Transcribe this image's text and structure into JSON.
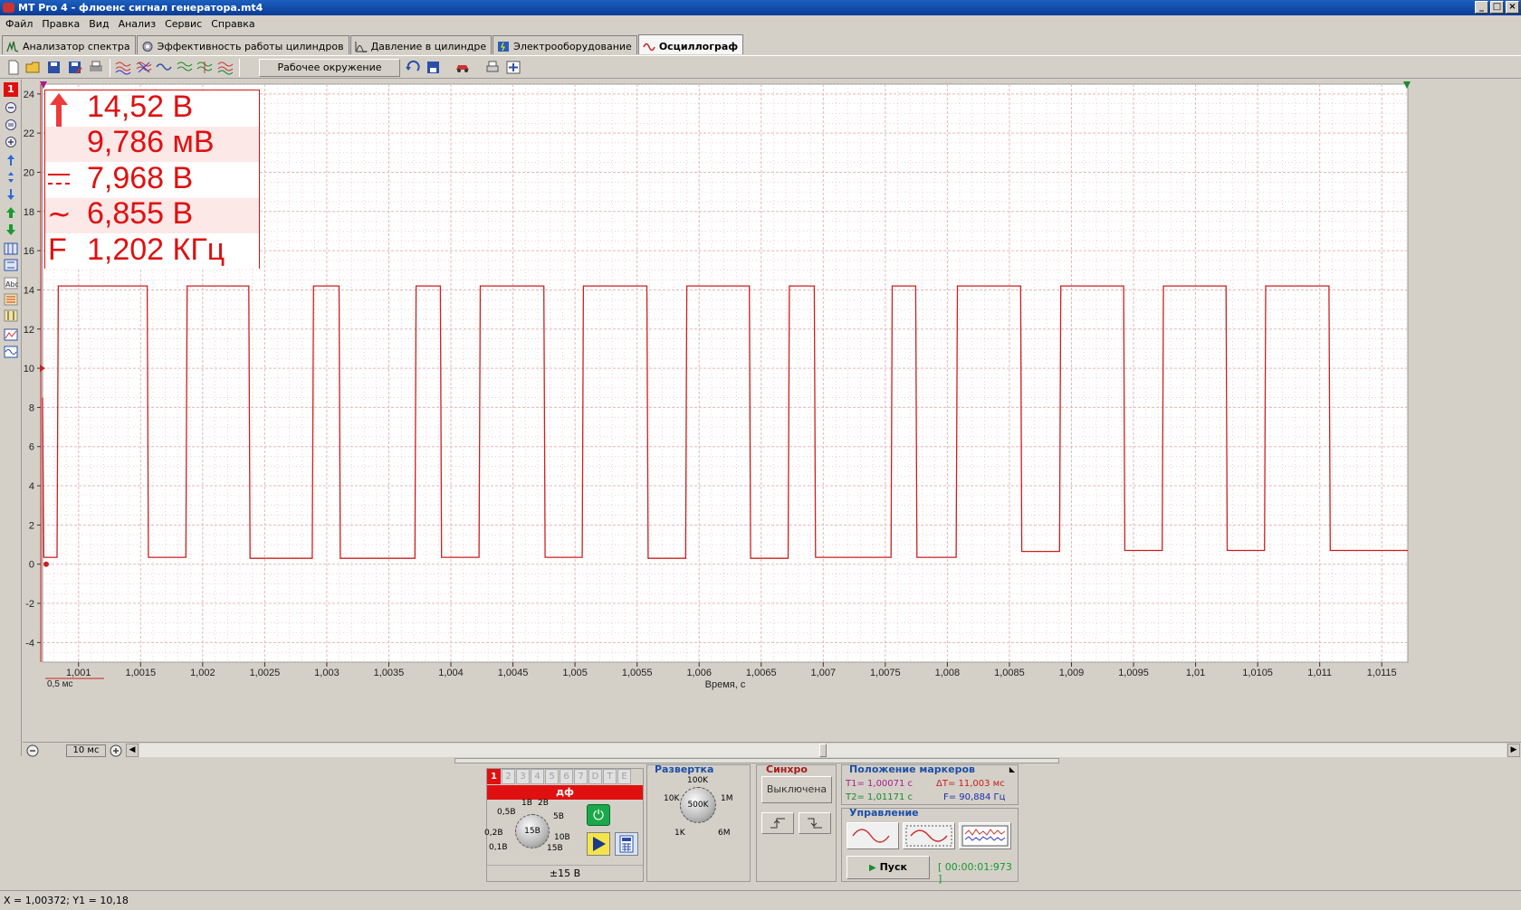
{
  "window": {
    "title": "MT Pro 4 - флюенс сигнал генератора.mt4"
  },
  "menu": [
    "Файл",
    "Правка",
    "Вид",
    "Анализ",
    "Сервис",
    "Справка"
  ],
  "tabs": [
    {
      "label": "Анализатор спектра",
      "icon": "spectrum-icon"
    },
    {
      "label": "Эффективность работы цилиндров",
      "icon": "cylinder-efficiency-icon"
    },
    {
      "label": "Давление в цилиндре",
      "icon": "pressure-icon"
    },
    {
      "label": "Электрооборудование",
      "icon": "electrical-icon"
    },
    {
      "label": "Осциллограф",
      "icon": "oscilloscope-icon",
      "active": true
    }
  ],
  "toolbar": {
    "environment_label": "Рабочее окружение"
  },
  "channel_indicator": "1",
  "measurements": [
    {
      "symbol": "↕",
      "value": "14,52 В",
      "icon": "peak-to-peak-icon"
    },
    {
      "symbol": "",
      "value": "9,786 мВ",
      "icon": "minimum-icon"
    },
    {
      "symbol": "⎓",
      "value": "7,968 В",
      "icon": "dc-average-icon"
    },
    {
      "symbol": "~",
      "value": "6,855 В",
      "icon": "ac-rms-icon"
    },
    {
      "symbol": "F",
      "value": "1,202 КГц",
      "icon": "frequency-icon"
    }
  ],
  "chart_data": {
    "type": "line",
    "xlabel": "Время, с",
    "ylabel": "",
    "xlim": [
      1.00071,
      1.01171
    ],
    "ylim": [
      -5,
      24.5
    ],
    "yticks": [
      -4,
      -2,
      0,
      2,
      4,
      6,
      8,
      10,
      12,
      14,
      16,
      18,
      20,
      22,
      24
    ],
    "xticks": [
      "1,001",
      "1,0015",
      "1,002",
      "1,0025",
      "1,003",
      "1,0035",
      "1,004",
      "1,0045",
      "1,005",
      "1,0055",
      "1,006",
      "1,0065",
      "1,007",
      "1,0075",
      "1,008",
      "1,0085",
      "1,009",
      "1,0095",
      "1,01",
      "1,0105",
      "1,011",
      "1,0115"
    ],
    "xtick_values": [
      1.001,
      1.0015,
      1.002,
      1.0025,
      1.003,
      1.0035,
      1.004,
      1.0045,
      1.005,
      1.0055,
      1.006,
      1.0065,
      1.007,
      1.0075,
      1.008,
      1.0085,
      1.009,
      1.0095,
      1.01,
      1.0105,
      1.011,
      1.0115
    ],
    "grid": true,
    "series": [
      {
        "color": "#cc1f1f",
        "high": 14.2,
        "low": 0.35,
        "pulses": [
          {
            "rise": 1.000837,
            "fall": 1.001553,
            "low_after": 0.35
          },
          {
            "rise": 1.001875,
            "fall": 1.002372,
            "low_after": 0.3
          },
          {
            "rise": 1.002893,
            "fall": 1.003099,
            "low_after": 0.3
          },
          {
            "rise": 1.00372,
            "fall": 1.003915,
            "low_after": 0.35
          },
          {
            "rise": 1.004237,
            "fall": 1.004749,
            "low_after": 0.35
          },
          {
            "rise": 1.005068,
            "fall": 1.005579,
            "low_after": 0.3
          },
          {
            "rise": 1.005901,
            "fall": 1.006405,
            "low_after": 0.3
          },
          {
            "rise": 1.006727,
            "fall": 1.006928,
            "low_after": 0.35
          },
          {
            "rise": 1.007556,
            "fall": 1.007745,
            "low_after": 0.35
          },
          {
            "rise": 1.008081,
            "fall": 1.00859,
            "low_after": 0.65
          },
          {
            "rise": 1.008914,
            "fall": 1.00942,
            "low_after": 0.7
          },
          {
            "rise": 1.009741,
            "fall": 1.010245,
            "low_after": 0.7
          },
          {
            "rise": 1.010565,
            "fall": 1.011075,
            "low_after": 0.7
          }
        ],
        "start_low": 0.35,
        "end_value": 0.7
      }
    ]
  },
  "scale_marker": "0,5 мс",
  "scroll": {
    "time_per_div": "10 мс"
  },
  "channel_panel": {
    "tabs": [
      "1",
      "2",
      "3",
      "4",
      "5",
      "6",
      "7",
      "D",
      "T",
      "E"
    ],
    "header": "дф",
    "knob_center": "15В",
    "knob_labels": [
      "0,1В",
      "0,2В",
      "0,5В",
      "1В",
      "2В",
      "5В",
      "10В",
      "15В"
    ],
    "range": "±15 В"
  },
  "sweep_panel": {
    "title": "Развертка",
    "knob_center": "500K",
    "knob_labels": [
      "1K",
      "10K",
      "100K",
      "1M",
      "6M"
    ]
  },
  "sync_panel": {
    "title": "Синхро",
    "state": "Выключена"
  },
  "markers_panel": {
    "title": "Положение маркеров",
    "t1": "T1= 1,00071 с",
    "dt": "ΔT= 11,003 мс",
    "t2": "T2= 1,01171 с",
    "f": "F= 90,884 Гц"
  },
  "control_panel": {
    "title": "Управление",
    "start_label": "Пуск",
    "timer": "[ 00:00:01:973 ]"
  },
  "status": "X = 1,00372; Y1 = 10,18",
  "colors": {
    "signal": "#cc1f1f",
    "grid": "#e6b8b8",
    "accent": "#e01010",
    "panel_title": "#1c4fa8"
  }
}
